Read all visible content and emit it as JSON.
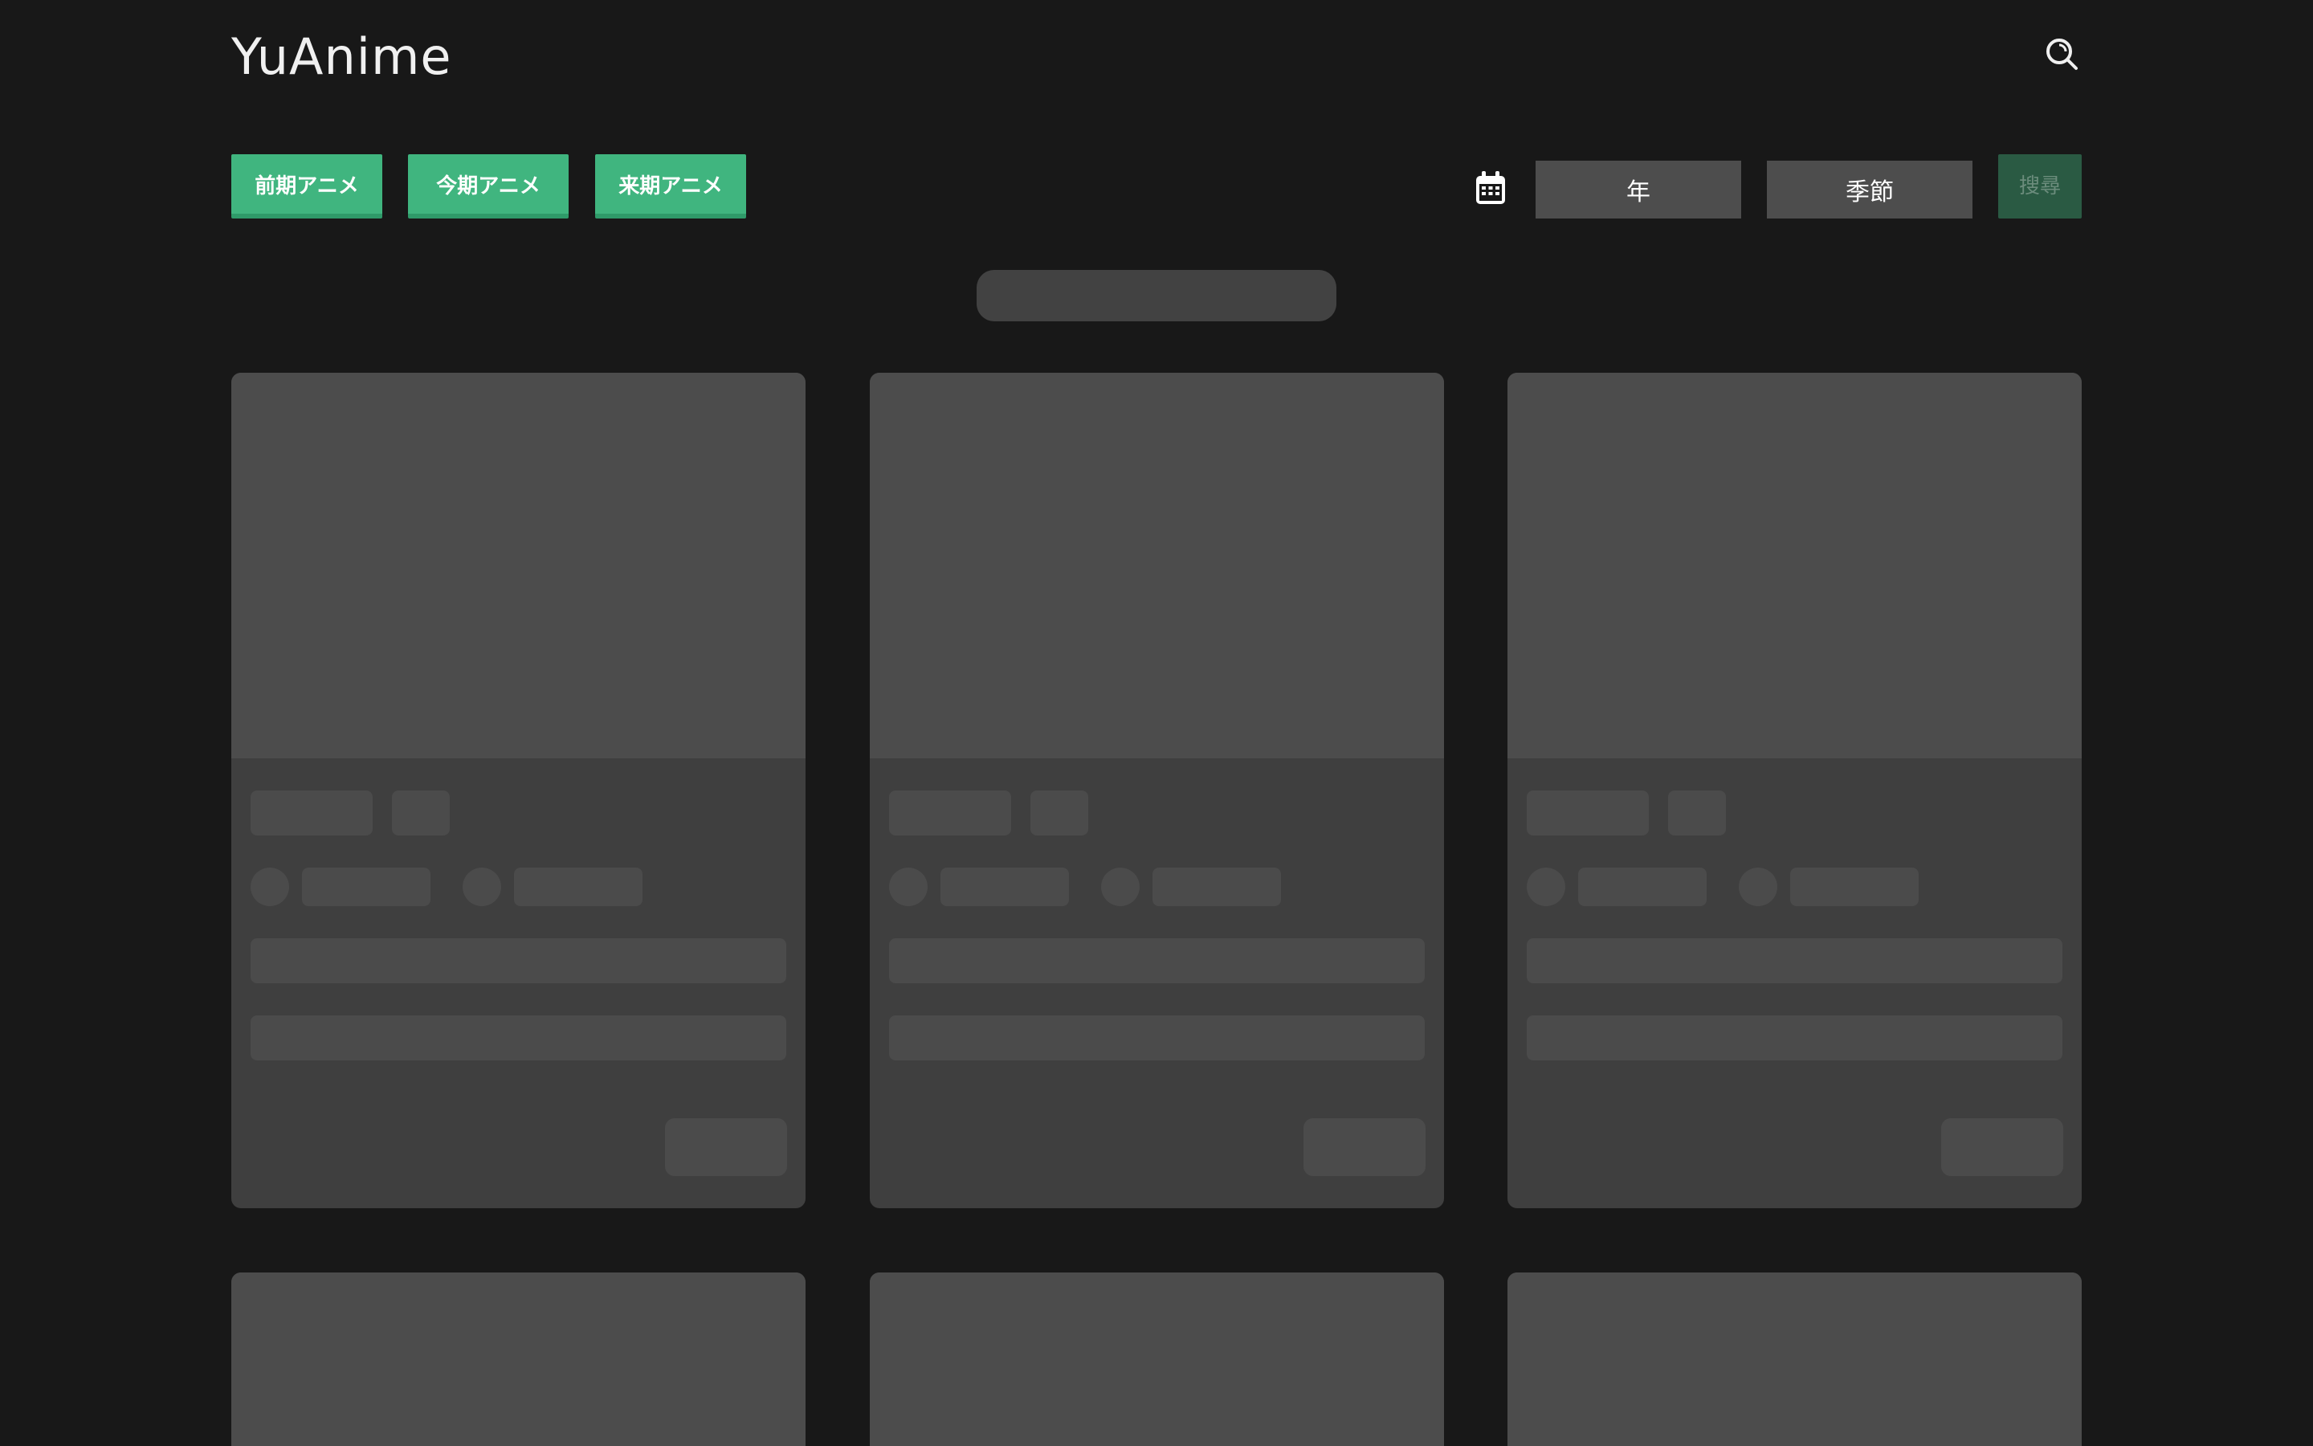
{
  "app": {
    "logo": "YuAnime"
  },
  "toolbar": {
    "prev_season_label": "前期アニメ",
    "current_season_label": "今期アニメ",
    "next_season_label": "来期アニメ",
    "year_select_label": "年",
    "season_select_label": "季節",
    "search_button_label": "搜尋"
  },
  "icons": {
    "search": "search-icon",
    "calendar": "calendar-icon"
  },
  "colors": {
    "background": "#181818",
    "accent": "#40b57f",
    "accent_dark": "#2a5a43",
    "skeleton": "#4c4c4c",
    "card": "#3f3f3f"
  },
  "content": {
    "state": "loading",
    "cards_visible": 6
  }
}
